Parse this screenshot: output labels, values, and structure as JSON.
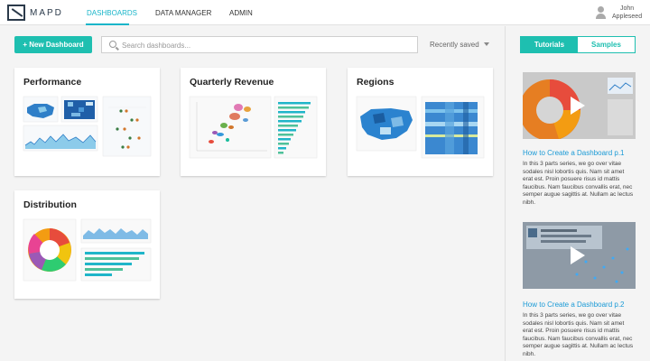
{
  "app": {
    "logo_text": "MAPD"
  },
  "nav": {
    "items": [
      {
        "label": "DASHBOARDS",
        "active": true
      },
      {
        "label": "DATA MANAGER",
        "active": false
      },
      {
        "label": "ADMIN",
        "active": false
      }
    ],
    "user_first": "John",
    "user_last": "Appleseed"
  },
  "toolbar": {
    "new_label": "+ New Dashboard",
    "search_placeholder": "Search dashboards...",
    "sort_label": "Recently saved"
  },
  "dashboards": [
    {
      "title": "Performance"
    },
    {
      "title": "Quarterly Revenue"
    },
    {
      "title": "Regions"
    },
    {
      "title": "Distribution"
    }
  ],
  "panel": {
    "tabs": [
      {
        "label": "Tutorials",
        "active": true
      },
      {
        "label": "Samples",
        "active": false
      }
    ],
    "tutorials": [
      {
        "title": "How to Create a Dashboard p.1",
        "desc": "In this 3 parts series, we go over vitae sodales nisl lobortis quis. Nam sit amet erat est. Proin posuere risus id mattis faucibus. Nam faucibus convallis erat, nec semper augue sagittis at. Nullam ac lectus nibh."
      },
      {
        "title": "How to Create a Dashboard p.2",
        "desc": "In this 3 parts series, we go over vitae sodales nisl lobortis quis. Nam sit amet erat est. Proin posuere risus id mattis faucibus. Nam faucibus convallis erat, nec semper augue sagittis at. Nullam ac lectus nibh."
      }
    ]
  },
  "colors": {
    "accent": "#1ebfb0",
    "link": "#1a9ad6",
    "nav_active": "#19b5c9"
  }
}
